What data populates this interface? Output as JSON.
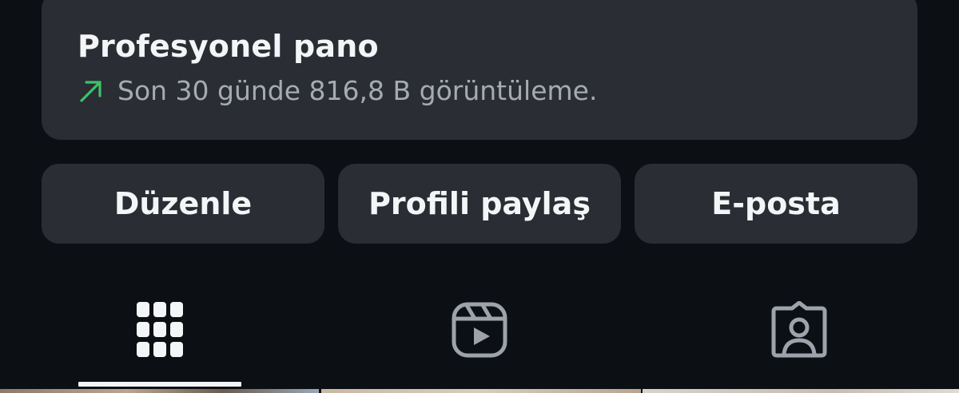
{
  "dashboard": {
    "title": "Profesyonel pano",
    "subtitle": "Son 30 günde 816,8 B görüntüleme.",
    "trend_icon": "arrow-up-right-icon",
    "trend_color": "#3ec16b"
  },
  "actions": {
    "edit_label": "Düzenle",
    "share_label": "Profili paylaş",
    "email_label": "E-posta"
  },
  "tabs": {
    "items": [
      {
        "icon": "grid-icon",
        "active": true
      },
      {
        "icon": "reels-icon",
        "active": false
      },
      {
        "icon": "tagged-person-icon",
        "active": false
      }
    ]
  },
  "colors": {
    "background": "#0c0f14",
    "card": "#2a2d33",
    "text": "#f4f5f7",
    "muted": "#a6abb3",
    "icon_inactive": "#9ea3ab"
  }
}
